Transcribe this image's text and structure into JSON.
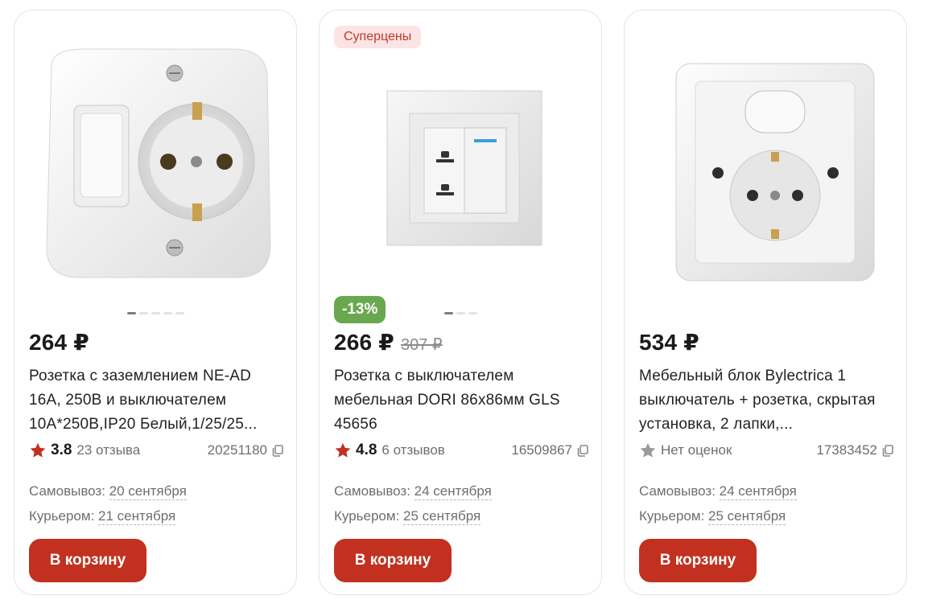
{
  "products": [
    {
      "badge": "",
      "discount": "",
      "price": "264 ₽",
      "old_price": "",
      "title": "Розетка с заземлением NE-AD 16А, 250В и выключателем 10А*250В,IP20 Белый,1/25/25...",
      "rating": "3.8",
      "reviews": "23 отзыва",
      "sku": "20251180",
      "pickup_label": "Самовывоз:",
      "pickup_date": "20 сентября",
      "courier_label": "Курьером:",
      "courier_date": "21 сентября",
      "button": "В корзину",
      "dots": 5,
      "active_dot": 0,
      "star_color": "#c2311f"
    },
    {
      "badge": "Суперцены",
      "discount": "-13%",
      "price": "266 ₽",
      "old_price": "307 ₽",
      "title": "Розетка с выключателем мебельная DORI 86х86мм GLS 45656",
      "rating": "4.8",
      "reviews": "6 отзывов",
      "sku": "16509867",
      "pickup_label": "Самовывоз:",
      "pickup_date": "24 сентября",
      "courier_label": "Курьером:",
      "courier_date": "25 сентября",
      "button": "В корзину",
      "dots": 3,
      "active_dot": 0,
      "star_color": "#c2311f"
    },
    {
      "badge": "",
      "discount": "",
      "price": "534 ₽",
      "old_price": "",
      "title": "Мебельный блок Bylectrica 1 выключатель + розетка, скрытая установка, 2 лапки,...",
      "rating": "",
      "reviews": "Нет оценок",
      "sku": "17383452",
      "pickup_label": "Самовывоз:",
      "pickup_date": "24 сентября",
      "courier_label": "Курьером:",
      "courier_date": "25 сентября",
      "button": "В корзину",
      "dots": 0,
      "active_dot": 0,
      "star_color": "#9a9a9a"
    }
  ],
  "colors": {
    "accent": "#c2311f",
    "discount_bg": "#6aa84f",
    "badge_bg": "#fbe4e4",
    "badge_text": "#c03a2b"
  }
}
